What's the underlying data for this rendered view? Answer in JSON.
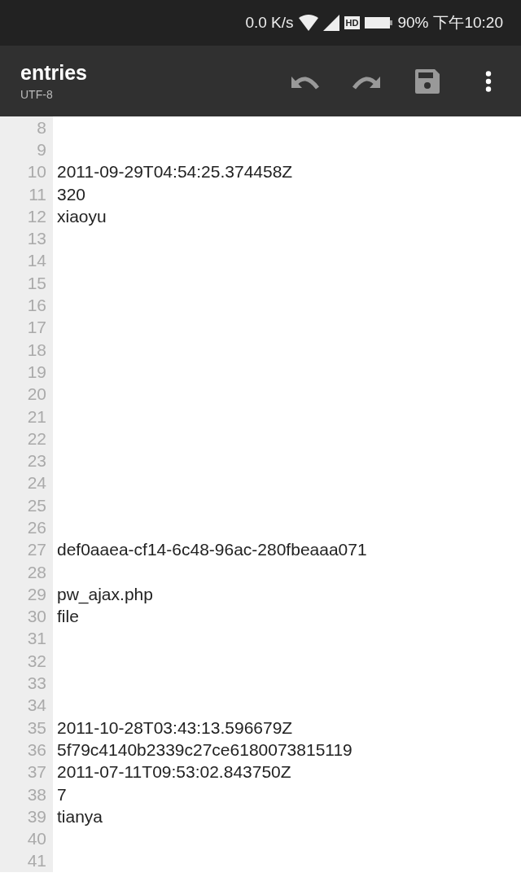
{
  "status_bar": {
    "speed": "0.0 K/s",
    "hd_badge": "HD",
    "battery": "90%",
    "time": "下午10:20"
  },
  "toolbar": {
    "title": "entries",
    "subtitle": "UTF-8"
  },
  "editor": {
    "lines": [
      {
        "number": "8"
      },
      {
        "number": "9"
      },
      {
        "number": "10",
        "text": "2011-09-29T04:54:25.374458Z"
      },
      {
        "number": "11",
        "text": "320"
      },
      {
        "number": "12",
        "text": "xiaoyu"
      },
      {
        "number": "13"
      },
      {
        "number": "14"
      },
      {
        "number": "15"
      },
      {
        "number": "16"
      },
      {
        "number": "17"
      },
      {
        "number": "18"
      },
      {
        "number": "19"
      },
      {
        "number": "20"
      },
      {
        "number": "21"
      },
      {
        "number": "22"
      },
      {
        "number": "23"
      },
      {
        "number": "24"
      },
      {
        "number": "25"
      },
      {
        "number": "26"
      },
      {
        "number": "27",
        "text": "def0aaea-cf14-6c48-96ac-280fbeaaa071"
      },
      {
        "number": "28"
      },
      {
        "number": "29",
        "text": "pw_ajax.php"
      },
      {
        "number": "30",
        "text": "file"
      },
      {
        "number": "31"
      },
      {
        "number": "32"
      },
      {
        "number": "33"
      },
      {
        "number": "34"
      },
      {
        "number": "35",
        "text": "2011-10-28T03:43:13.596679Z"
      },
      {
        "number": "36",
        "text": "5f79c4140b2339c27ce6180073815119"
      },
      {
        "number": "37",
        "text": "2011-07-11T09:53:02.843750Z"
      },
      {
        "number": "38",
        "text": "7"
      },
      {
        "number": "39",
        "text": "tianya"
      },
      {
        "number": "40"
      },
      {
        "number": "41"
      }
    ]
  }
}
